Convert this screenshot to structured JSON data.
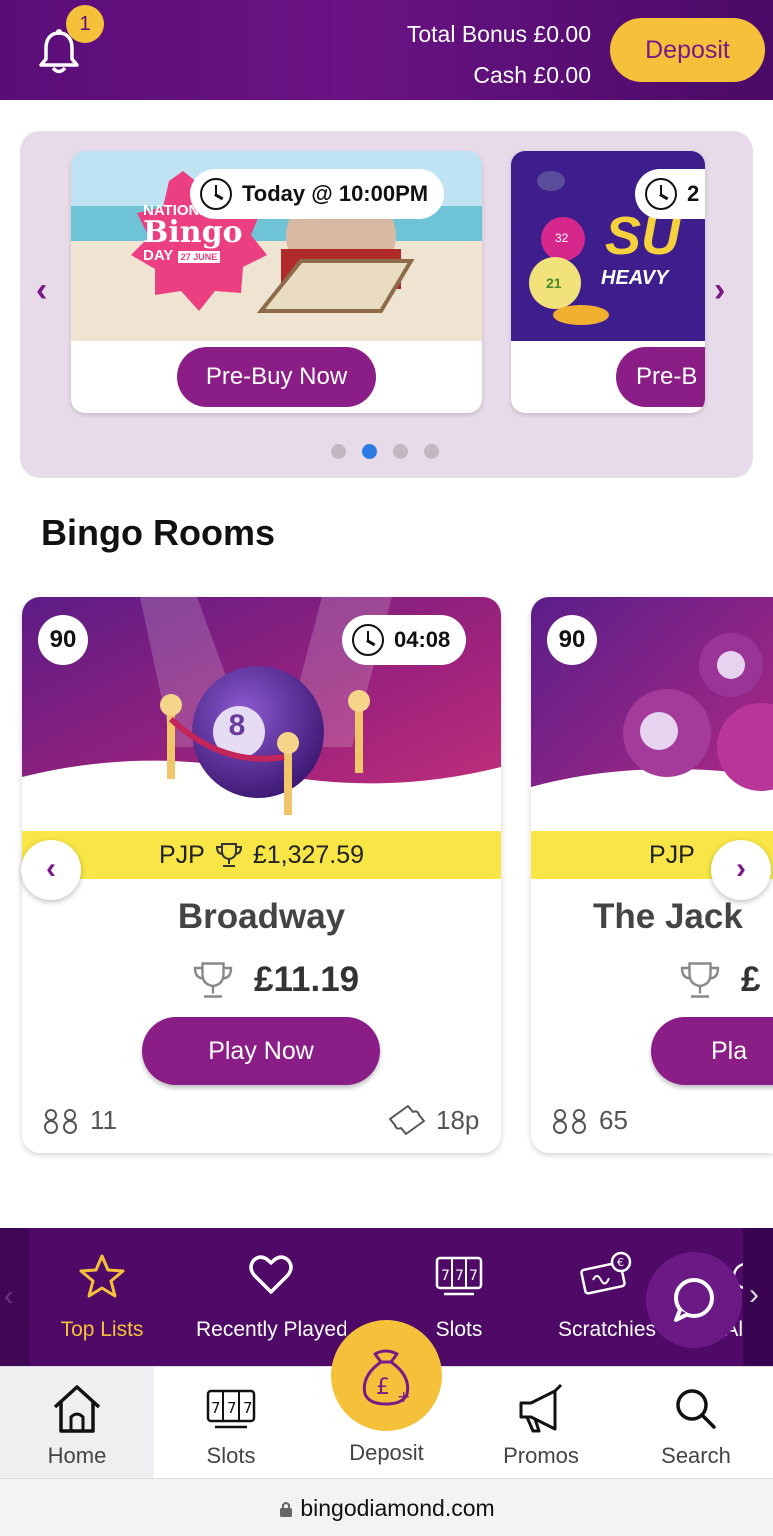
{
  "header": {
    "notifications_count": "1",
    "total_bonus": "Total Bonus £0.00",
    "cash": "Cash £0.00",
    "deposit_label": "Deposit"
  },
  "promo_carousel": {
    "slides": [
      {
        "time": "Today @ 10:00PM",
        "button": "Pre-Buy Now",
        "art_text": [
          "NATIONAL",
          "Bingo",
          "DAY",
          "27 JUNE"
        ]
      },
      {
        "time": "2",
        "button": "Pre-B",
        "art_text": [
          "SU",
          "HEAVY",
          "32",
          "21"
        ]
      }
    ],
    "active_dot": 1,
    "dot_count": 4
  },
  "bingo_rooms": {
    "title": "Bingo Rooms",
    "rooms": [
      {
        "ball_type": "90",
        "timer": "04:08",
        "pjp": "PJP",
        "pjp_value": "£1,327.59",
        "name": "Broadway",
        "prize": "£11.19",
        "button": "Play Now",
        "players": "11",
        "ticket_price": "18p",
        "ball_number": "8"
      },
      {
        "ball_type": "90",
        "pjp": "PJP",
        "name": "The Jack",
        "prize": "£",
        "button": "Pla",
        "players": "65"
      }
    ]
  },
  "category_nav": {
    "items": [
      {
        "label": "Top Lists",
        "icon": "star-icon",
        "active": true
      },
      {
        "label": "Recently Played",
        "icon": "heart-icon"
      },
      {
        "label": "Slots",
        "icon": "slot-machine-icon"
      },
      {
        "label": "Scratchies",
        "icon": "scratch-card-icon"
      },
      {
        "label": "All",
        "icon": "grid-icon"
      }
    ]
  },
  "tab_bar": {
    "items": [
      {
        "label": "Home",
        "icon": "home-icon",
        "active": true
      },
      {
        "label": "Slots",
        "icon": "slot-machine-icon"
      },
      {
        "label": "Deposit",
        "icon": "money-bag-icon"
      },
      {
        "label": "Promos",
        "icon": "megaphone-icon"
      },
      {
        "label": "Search",
        "icon": "search-icon"
      }
    ]
  },
  "browser": {
    "url": "bingodiamond.com"
  },
  "colors": {
    "purple": "#5a0d78",
    "button_purple": "#8a1d86",
    "yellow": "#f5c13b",
    "pjp_yellow": "#f7e645",
    "active_dot": "#2d7be5"
  }
}
